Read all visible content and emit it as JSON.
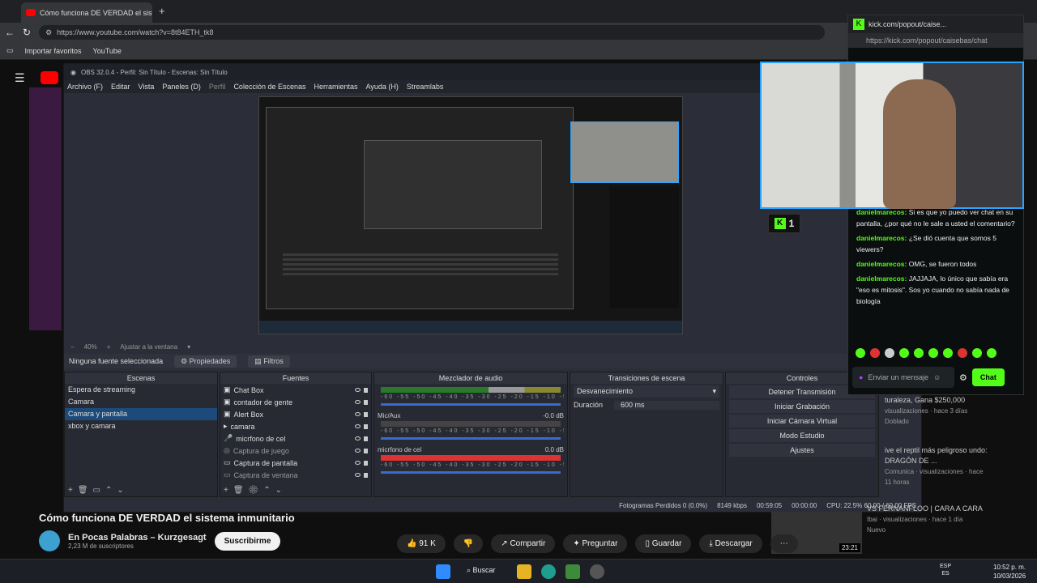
{
  "browser": {
    "tab_title": "Cómo funciona DE VERDAD el sistema inmunitario",
    "url": "https://www.youtube.com/watch?v=8t84ETH_tk8",
    "bookmarks": [
      "Importar favoritos",
      "YouTube"
    ]
  },
  "obs": {
    "title": "OBS 32.0.4 - Perfil: Sin Título - Escenas: Sin Título",
    "menu": [
      "Archivo (F)",
      "Editar",
      "Vista",
      "Paneles (D)",
      "Perfil",
      "Colección de Escenas",
      "Herramientas",
      "Ayuda (H)",
      "Streamlabs"
    ],
    "zoom": "40%",
    "fit_label": "Ajustar a la ventana",
    "no_source": "Ninguna fuente seleccionada",
    "properties": "Propiedades",
    "filters": "Filtros",
    "scenes_header": "Escenas",
    "scenes": [
      "Espera de streaming",
      "Camara",
      "Camara y pantalla",
      "xbox y camara"
    ],
    "sources_header": "Fuentes",
    "sources": [
      "Chat Box",
      "contador de gente",
      "Alert Box",
      "camara",
      "micrfono de cel",
      "Captura de juego",
      "Captura de pantalla",
      "Captura de ventana"
    ],
    "mixer_header": "Mezclador de audio",
    "mixer": [
      {
        "name": "",
        "db": ""
      },
      {
        "name": "Mic/Aux",
        "db": "-0.0 dB"
      },
      {
        "name": "micrfono de cel",
        "db": "0.0 dB"
      }
    ],
    "meter_scale": "-60 -55 -50 -45 -40 -35 -30 -25 -20 -15 -10 -5 0",
    "transitions_header": "Transiciones de escena",
    "transition": "Desvanecimiento",
    "duration_label": "Duración",
    "duration": "600 ms",
    "controls_header": "Controles",
    "controls": [
      "Detener Transmisión",
      "Iniciar Grabación",
      "Iniciar Cámara Virtual",
      "Modo Estudio",
      "Ajustes"
    ],
    "status": {
      "frames": "Fotogramas Perdidos 0 (0.0%)",
      "bitrate": "8149 kbps",
      "live_time": "00:59:05",
      "rec_time": "00:00:00",
      "cpu": "CPU: 22.5% 60.00 / 60.00 FPS"
    }
  },
  "kick": {
    "title": "kick.com/popout/caise...",
    "url": "https://kick.com/popout/caisebas/chat",
    "viewers": "1",
    "messages": [
      {
        "user": "danielmarecos:",
        "text": "Si es que yo puedo ver chat en su pantalla, ¿por qué no le sale a usted el comentario?"
      },
      {
        "user": "danielmarecos:",
        "text": "¿Se dió cuenta que somos 5 viewers?"
      },
      {
        "user": "danielmarecos:",
        "text": "OMG, se fueron todos"
      },
      {
        "user": "danielmarecos:",
        "text": "JAJJAJA, lo único que sabía era \"eso es mitosis\". Sos yo cuando no sabía nada de biología"
      }
    ],
    "input_placeholder": "Enviar un mensaje",
    "send_label": "Chat"
  },
  "video": {
    "title": "Cómo funciona DE VERDAD el sistema inmunitario",
    "channel": "En Pocas Palabras – Kurzgesagt",
    "subscribers": "2,23 M de suscriptores",
    "subscribe": "Suscribirme",
    "likes": "91 K",
    "share": "Compartir",
    "ask": "Preguntar",
    "save": "Guardar",
    "download": "Descargar"
  },
  "recommendations": [
    {
      "title": "turaleza, Gana $250,000",
      "meta": "visualizaciones · hace 3 días",
      "badge": "Doblado"
    },
    {
      "title": "ive el reptil más peligroso undo: DRAGÓN DE ...",
      "meta": "Comunica · visualizaciones · hace 11 horas"
    },
    {
      "title": "VS FERNANFLOO | CARA A CARA",
      "meta": "Ibai · visualizaciones · hace 1 día",
      "badge": "Nuevo",
      "duration": "23:21"
    }
  ],
  "taskbar": {
    "search": "Buscar",
    "lang": "ESP",
    "lang2": "ES",
    "time": "10:52 p. m.",
    "date": "10/03/2026"
  }
}
